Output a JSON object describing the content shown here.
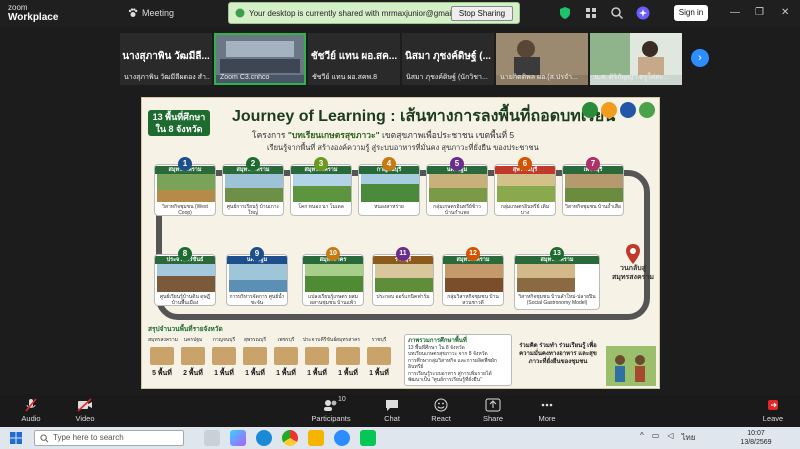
{
  "app": {
    "logo_line1": "zoom",
    "logo_line2": "Workplace",
    "meeting_label": "Meeting"
  },
  "share_banner": {
    "text": "Your desktop is currently shared with mrmaxjunior@gmail.com",
    "stop_label": "Stop Sharing"
  },
  "signin_label": "Sign in",
  "thumbnails": [
    {
      "name": "นางสุภาพิน วัฒมีลี...",
      "sub": "นางสุภาพิน วัฒมีลีผดอง สำ..."
    },
    {
      "name": "",
      "sub": "Zoom C3.cnhco"
    },
    {
      "name": "ชัชวีย์ แทน ผอ.สค...",
      "sub": "ชัชวีย์ แทน ผอ.สคพ.8"
    },
    {
      "name": "นิสมา ภุชงค์ดิษฐ์ (...",
      "sub": "นิสมา ภุชงค์ดิษฐ์ (นักวิชา..."
    },
    {
      "name": "",
      "sub": "นายกิตติพล ผอ.(ส.ปรจำ..."
    },
    {
      "name": "",
      "sub": "น.ส. ศิริกัญญา ตรูใส่สะ..."
    }
  ],
  "slide": {
    "badge": "13 พื้นที่ศึกษา ใน 8 จังหวัด",
    "title": "Journey of Learning : เส้นทางการลงพื้นที่ถอดบทเรียน",
    "project_prefix": "โครงการ ",
    "project_name": "\"บทเรียนเกษตรสุขภาวะ\"",
    "project_suffix": " เขตสุขภาพเพื่อประชาชน เขตพื้นที่ 5",
    "tagline": "เรียนรู้จากพื้นที่  สร้างองค์ความรู้  สู่ระบบอาหารที่มั่นคง  สุขภาวะที่ยั่งยืน  ของประชาชน",
    "stops": [
      {
        "num": "1",
        "province": "สมุทรสงคราม",
        "caption": "วิสาหกิจชุมชน (West Coop)"
      },
      {
        "num": "2",
        "province": "สมุทรสงคราม",
        "caption": "ศูนย์การเรียนรู้ บ้านเกาะใหญ่"
      },
      {
        "num": "3",
        "province": "สมุทรสงคราม",
        "caption": "โคก หนอง นา โมเดล"
      },
      {
        "num": "4",
        "province": "กาญจนบุรี",
        "caption": "หนองสาหร่าย"
      },
      {
        "num": "5",
        "province": "นครปฐม",
        "caption": "กลุ่มเกษตรอินทรีย์ข้าวบ้านกำแพง"
      },
      {
        "num": "6",
        "province": "สุพรรณบุรี",
        "caption": "กลุ่มเกษตรอินทรีย์ เดิมบาง"
      },
      {
        "num": "7",
        "province": "เพชรบุรี",
        "caption": "วิสาหกิจชุมชน บ้านถ้ำเสือ"
      },
      {
        "num": "8",
        "province": "ประจวบคีรีขันธ์",
        "caption": "ศูนย์เรียนรู้บ้านดิน ดุษฎี บ้านพื้นเมือง"
      },
      {
        "num": "9",
        "province": "นครปฐม",
        "caption": "การบริหารจัดการ ศูนย์น้ำชะจัน"
      },
      {
        "num": "10",
        "province": "สมุทรสาคร",
        "caption": "แปลงเรียนรู้เกษตร ผสมผสานชุมชน บ้านแพ้ว"
      },
      {
        "num": "11",
        "province": "ราชบุรี",
        "caption": "ประกอบ ออร์แกนิคฟาร์ม"
      },
      {
        "num": "12",
        "province": "สมุทรสงคราม",
        "caption": "กลุ่มวิสาหกิจชุมชน บ้านสวนชาวดี"
      },
      {
        "num": "13",
        "province": "สมุทรสงคราม",
        "caption": "วิสาหกิจชุมชน บ้านลำใหม่-ปลายปิน (Social Gastronomy Model)"
      }
    ],
    "end_label": "วนกลับสู่ สมุทรสงคราม",
    "summary_title": "สรุปจำนวนพื้นที่รายจังหวัด",
    "summary": [
      {
        "province": "สมุทรสงคราม",
        "count": "5 พื้นที่"
      },
      {
        "province": "นครปฐม",
        "count": "2 พื้นที่"
      },
      {
        "province": "กาญจนบุรี",
        "count": "1 พื้นที่"
      },
      {
        "province": "สุพรรณบุรี",
        "count": "1 พื้นที่"
      },
      {
        "province": "เพชรบุรี",
        "count": "1 พื้นที่"
      },
      {
        "province": "ประจวบคีรีขันธ์",
        "count": "1 พื้นที่"
      },
      {
        "province": "สมุทรสาคร",
        "count": "1 พื้นที่"
      },
      {
        "province": "ราชบุรี",
        "count": "1 พื้นที่"
      }
    ],
    "results_title": "ภาพรวมการศึกษาพื้นที่",
    "results_lines": [
      "13 พื้นที่ศึกษา ใน 8 จังหวัด",
      "บทเรียนเกษตรสุขภาวะ จาก 8 จังหวัด",
      "การศึกษากลุ่มวิสาหกิจ และการผลิตพืชผักอินทรีย์",
      "การเรียนรู้ระบบอาหาร สู่การเพิ่มรายได้",
      "พัฒนาเป็น \"ศูนย์การเรียนรู้ที่ยั่งยืน\""
    ],
    "quote": "ร่วมคิด ร่วมทำ ร่วมเรียนรู้ เพื่อความมั่นคงทางอาหาร และสุขภาวะที่ยั่งยืนของชุมชน"
  },
  "toolbar": {
    "audio": "Audio",
    "video": "Video",
    "participants": "Participants",
    "participants_count": "10",
    "chat": "Chat",
    "react": "React",
    "share": "Share",
    "more": "More",
    "leave": "Leave"
  },
  "taskbar": {
    "search_placeholder": "Type here to search",
    "lang": "ไทย",
    "time": "10:07",
    "date": "13/8/2569"
  },
  "colors": {
    "zoom_blue": "#2d8cff",
    "banner_green": "#d5f0c8",
    "leave_red": "#e02828"
  }
}
